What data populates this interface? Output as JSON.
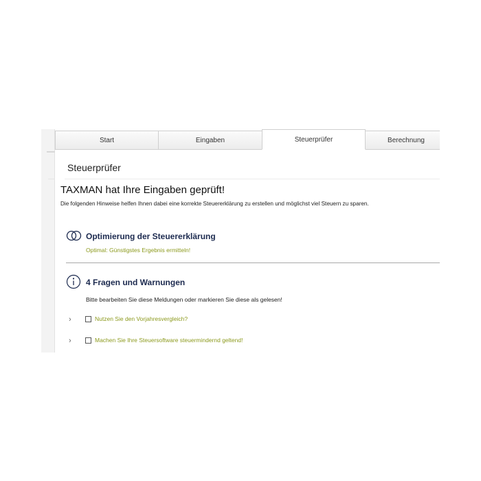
{
  "tabs": [
    {
      "label": "Start"
    },
    {
      "label": "Eingaben"
    },
    {
      "label": "Steuerprüfer"
    },
    {
      "label": "Berechnung"
    }
  ],
  "active_tab": "Steuerprüfer",
  "page": {
    "title": "Steuerprüfer",
    "headline": "TAXMAN hat Ihre Eingaben geprüft!",
    "intro": "Die folgenden Hinweise helfen Ihnen dabei eine korrekte Steuererklärung zu erstellen und möglichst viel Steuern zu sparen."
  },
  "optimization": {
    "icon": "rings-icon",
    "title": "Optimierung der Steuererklärung",
    "link": "Optimal: Günstigstes Ergebnis ermitteln!"
  },
  "warnings": {
    "icon": "info-icon",
    "title": "4 Fragen und Warnungen",
    "subtitle": "Bitte bearbeiten Sie diese Meldungen oder markieren Sie diese als gelesen!",
    "items": [
      {
        "label": "Nutzen Sie den Vorjahresvergleich?",
        "checked": false
      },
      {
        "label": "Machen Sie Ihre Steuersoftware steuermindernd geltend!",
        "checked": false
      }
    ]
  },
  "colors": {
    "link_green": "#8c9a1e",
    "heading_navy": "#1c2a4f"
  }
}
